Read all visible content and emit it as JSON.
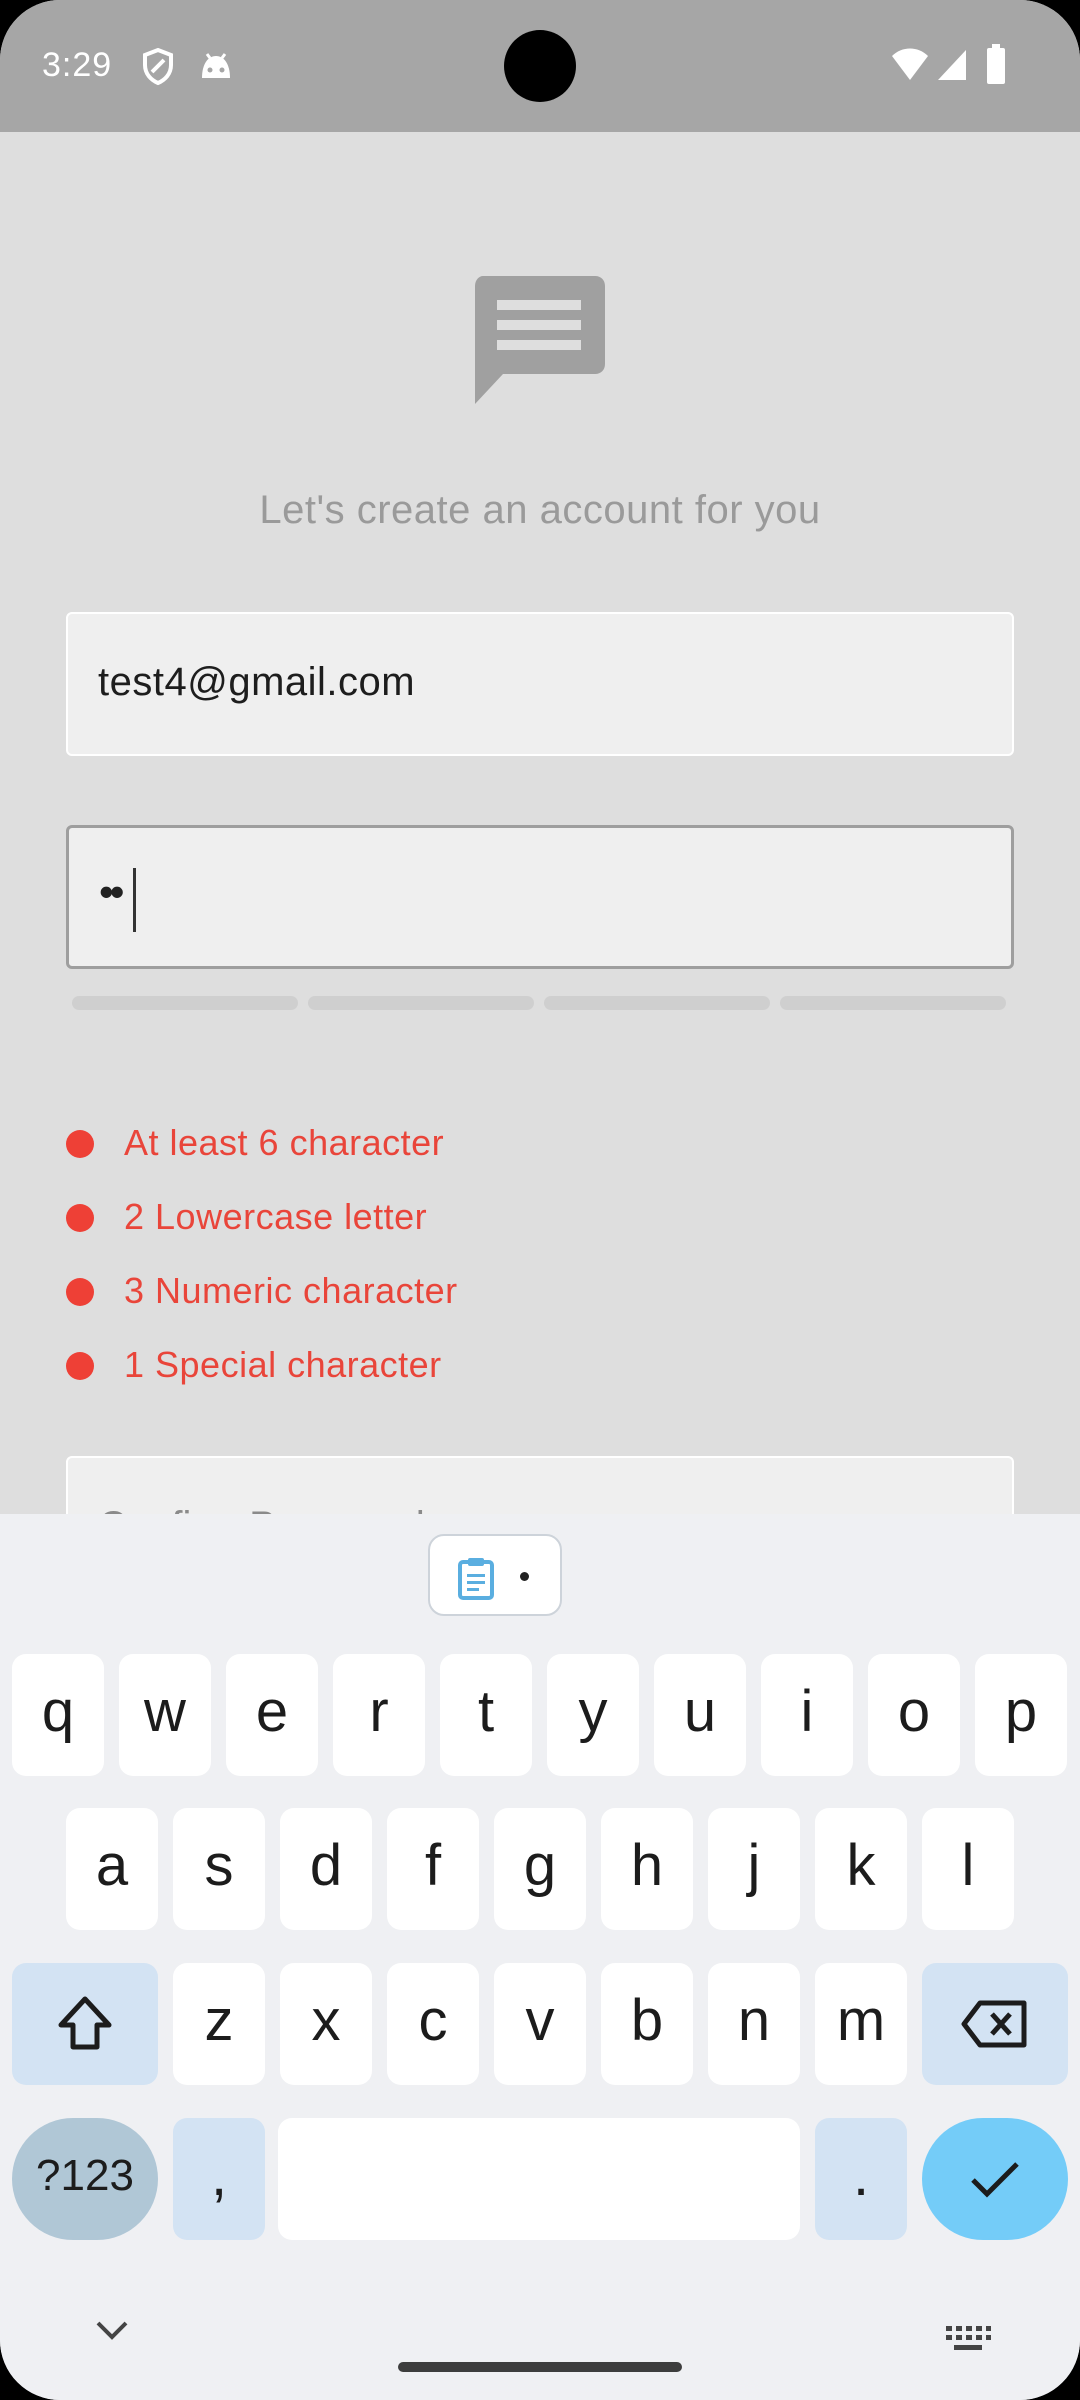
{
  "status_bar": {
    "time": "3:29",
    "icons": [
      "shield-icon",
      "android-icon",
      "wifi-icon",
      "cell-signal-icon",
      "battery-icon"
    ]
  },
  "app": {
    "logo_icon": "chat-bubble-icon",
    "subtitle": "Let's create an account for you",
    "email_value": "test4@gmail.com",
    "password_value": "••",
    "confirm_placeholder": "Confirm Password",
    "requirements": [
      {
        "text": "At least 6 character",
        "met": false
      },
      {
        "text": "2 Lowercase letter",
        "met": false
      },
      {
        "text": "3 Numeric character",
        "met": false
      },
      {
        "text": "1 Special character",
        "met": false
      }
    ],
    "colors": {
      "unmet": "#e9453a",
      "background": "#dedede"
    }
  },
  "keyboard": {
    "clipboard_icon": "clipboard-icon",
    "row1": [
      "q",
      "w",
      "e",
      "r",
      "t",
      "y",
      "u",
      "i",
      "o",
      "p"
    ],
    "row2": [
      "a",
      "s",
      "d",
      "f",
      "g",
      "h",
      "j",
      "k",
      "l"
    ],
    "row3": [
      "z",
      "x",
      "c",
      "v",
      "b",
      "n",
      "m"
    ],
    "symbols_label": "?123",
    "comma": ",",
    "period": ".",
    "accent_color": "#74ccf8"
  }
}
